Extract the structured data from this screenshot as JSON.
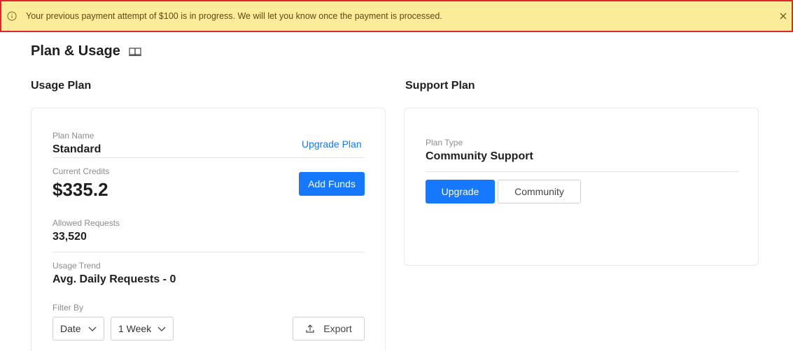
{
  "banner": {
    "message": "Your previous payment attempt of $100 is in progress. We will let you know once the payment is processed."
  },
  "page": {
    "title": "Plan & Usage"
  },
  "usage_plan": {
    "heading": "Usage Plan",
    "plan_name_label": "Plan Name",
    "plan_name_value": "Standard",
    "upgrade_plan_link": "Upgrade Plan",
    "current_credits_label": "Current Credits",
    "current_credits_value": "$335.2",
    "add_funds_button": "Add Funds",
    "allowed_requests_label": "Allowed Requests",
    "allowed_requests_value": "33,520",
    "usage_trend_label": "Usage Trend",
    "usage_trend_value": "Avg. Daily Requests - 0",
    "filter_by_label": "Filter By",
    "filter_select": {
      "selected": "Date"
    },
    "period_select": {
      "selected": "1 Week"
    },
    "export_button": "Export"
  },
  "support_plan": {
    "heading": "Support Plan",
    "plan_type_label": "Plan Type",
    "plan_type_value": "Community Support",
    "upgrade_button": "Upgrade",
    "community_button": "Community"
  },
  "colors": {
    "banner_bg": "#fbec9a",
    "banner_border": "#e0262b",
    "primary": "#1677ff"
  },
  "icons": [
    "info-icon",
    "close-icon",
    "book-icon",
    "chevron-down-icon",
    "upload-icon"
  ]
}
